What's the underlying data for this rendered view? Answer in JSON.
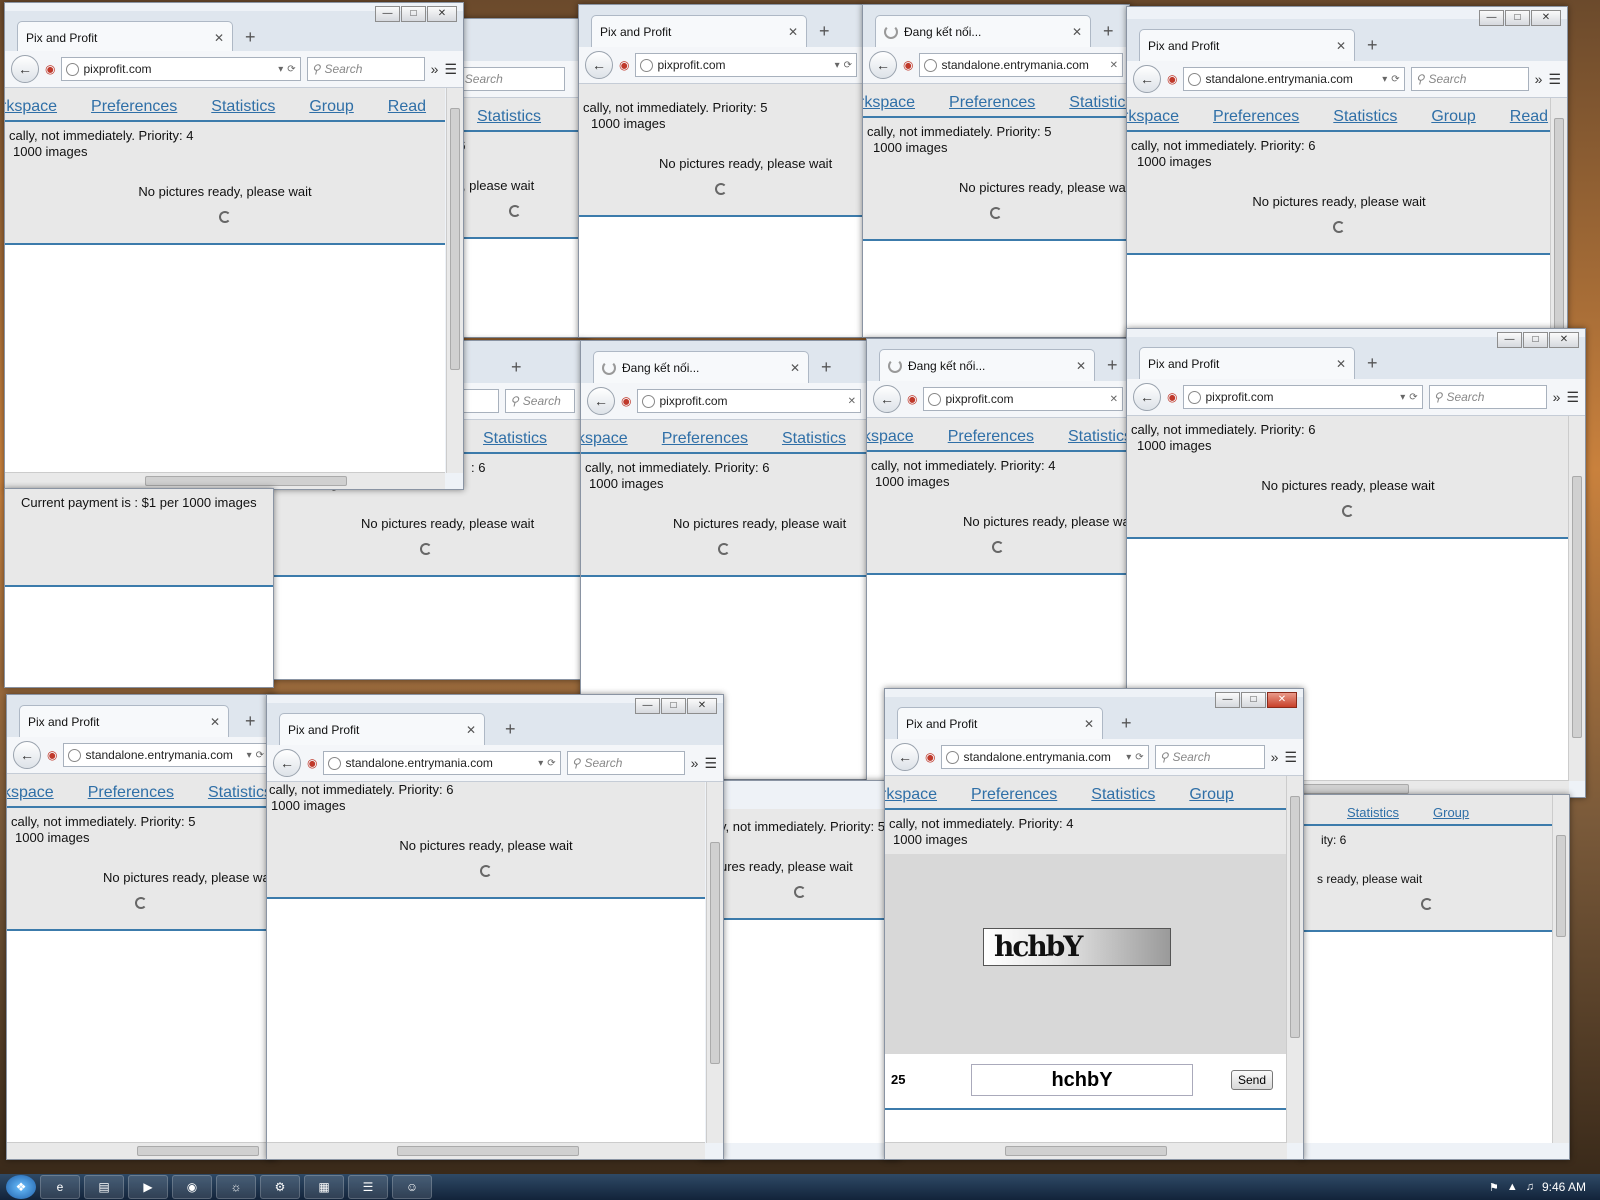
{
  "tab_title": "Pix and Profit",
  "tab_loading_title": "Đang kết nối...",
  "url_pix": "pixprofit.com",
  "url_standalone": "standalone.entrymania.com",
  "search_placeholder": "Search",
  "nav": {
    "workspace": "rkspace",
    "workspace2": "kspace",
    "preferences": "Preferences",
    "statistics": "Statistics",
    "group": "Group",
    "read": "Read"
  },
  "msgs": {
    "p4": "cally, not immediately. Priority: 4",
    "p5": "cally, not immediately. Priority: 5",
    "p6": "cally, not immediately. Priority: 6",
    "images": "1000 images",
    "wait": "No pictures ready, please wait",
    "payment": "Current payment is : $1 per 1000 images"
  },
  "captcha": {
    "image_text": "hchbY",
    "answer": "hchbY",
    "number": "25",
    "send": "Send"
  },
  "taskbar": {
    "clock": "9:46 AM"
  },
  "colors": {
    "link": "#2f6fa7",
    "accent_line": "#3c7bab"
  }
}
